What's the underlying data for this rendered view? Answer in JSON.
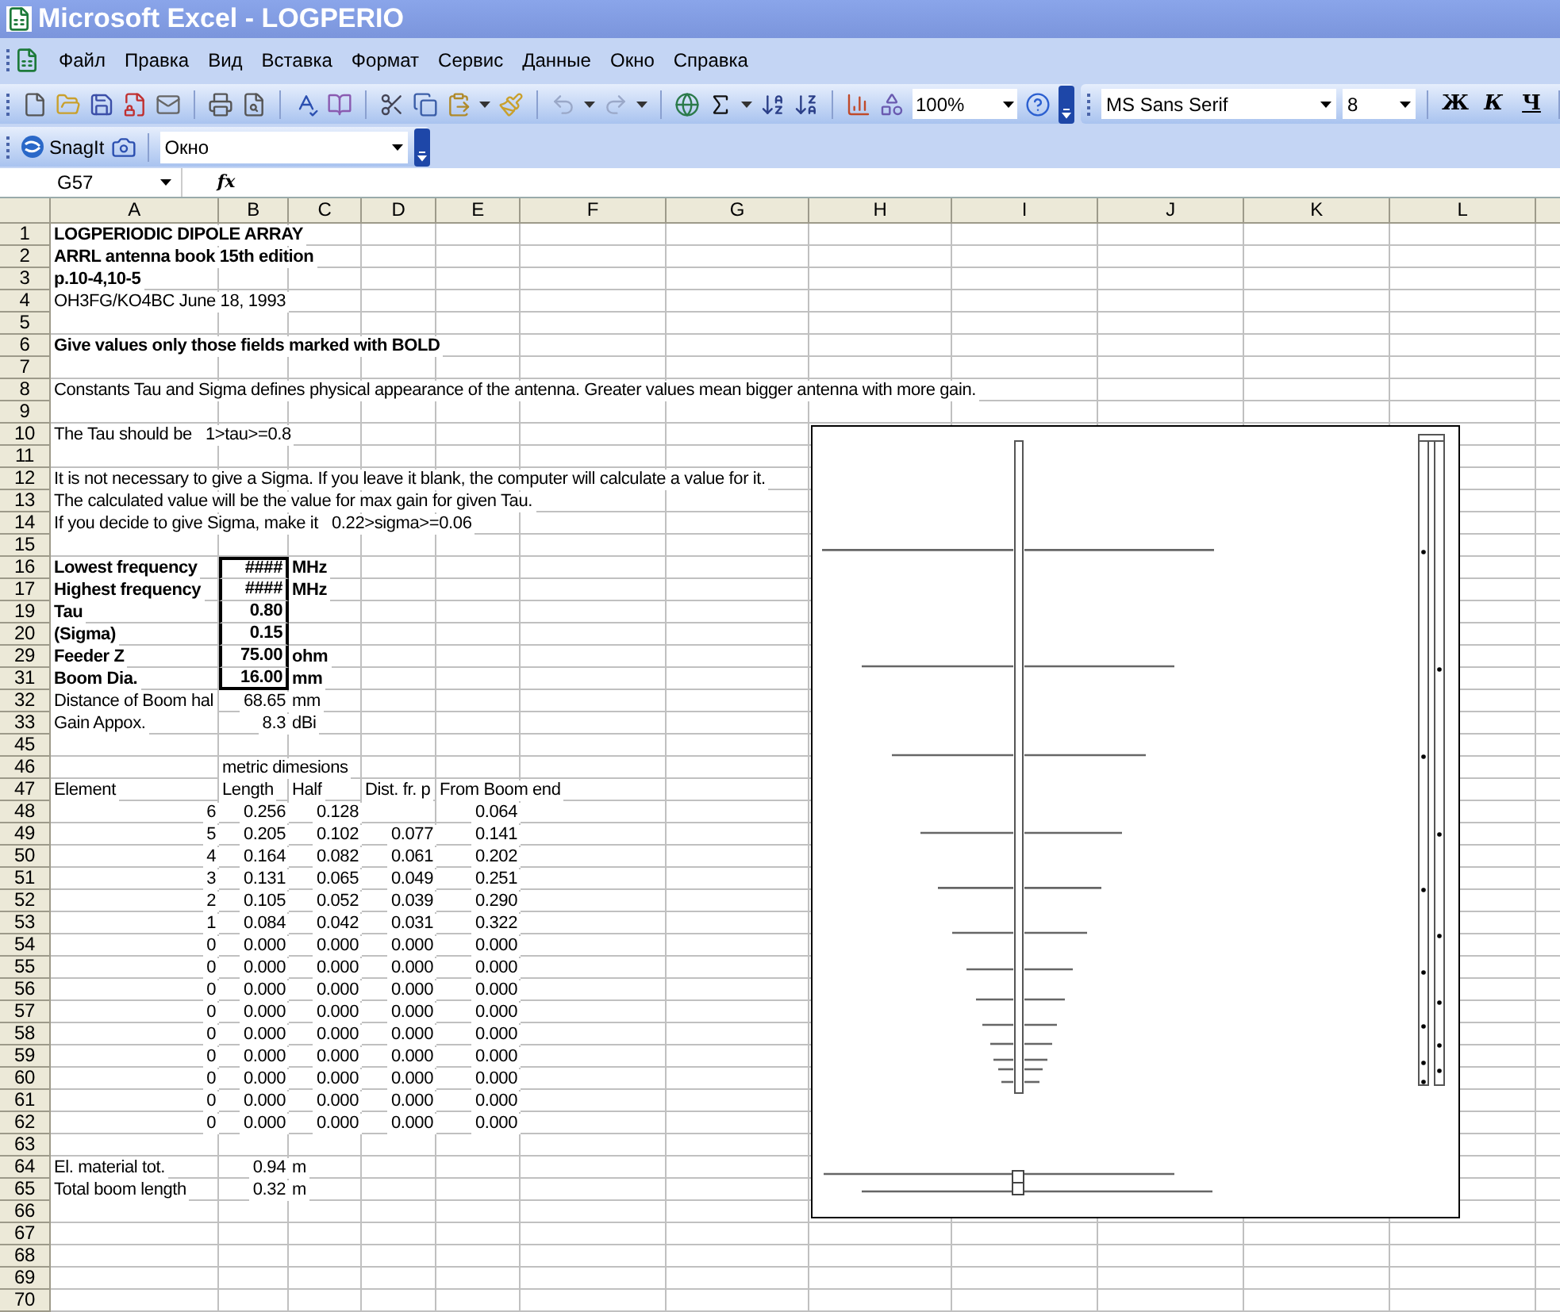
{
  "window": {
    "title": "Microsoft Excel - LOGPERIO"
  },
  "menu": [
    "Файл",
    "Правка",
    "Вид",
    "Вставка",
    "Формат",
    "Сервис",
    "Данные",
    "Окно",
    "Справка"
  ],
  "standard_toolbar": {
    "zoom": "100%"
  },
  "formatting_toolbar": {
    "font": "MS Sans Serif",
    "size": "8",
    "style_buttons": [
      "Ж",
      "К",
      "Ч"
    ]
  },
  "snagit_toolbar": {
    "label": "SnagIt",
    "dropdown": "Окно"
  },
  "formula_bar": {
    "name_box": "G57",
    "function_label": "fx"
  },
  "columns": [
    "A",
    "B",
    "C",
    "D",
    "E",
    "F",
    "G",
    "H",
    "I",
    "J",
    "K",
    "L"
  ],
  "rows": [
    {
      "header": "1",
      "cells": [
        {
          "text": "LOGPERIODIC DIPOLE ARRAY",
          "kind": "text",
          "bold": true,
          "boxed": false
        }
      ]
    },
    {
      "header": "2",
      "cells": [
        {
          "text": "ARRL antenna book 15th edition",
          "kind": "text",
          "bold": true,
          "boxed": false
        }
      ]
    },
    {
      "header": "3",
      "cells": [
        {
          "text": "p.10-4,10-5",
          "kind": "text",
          "bold": true,
          "boxed": false
        }
      ]
    },
    {
      "header": "4",
      "cells": [
        {
          "text": "OH3FG/KO4BC June 18, 1993",
          "kind": "text",
          "bold": false,
          "boxed": false
        }
      ]
    },
    {
      "header": "5",
      "cells": []
    },
    {
      "header": "6",
      "cells": [
        {
          "text": "Give values only those fields marked with BOLD",
          "kind": "text",
          "bold": true,
          "boxed": false
        }
      ]
    },
    {
      "header": "7",
      "cells": []
    },
    {
      "header": "8",
      "cells": [
        {
          "text": "Constants Tau and Sigma defines physical appearance of the antenna. Greater values mean bigger antenna with more gain.",
          "kind": "text",
          "bold": false,
          "boxed": false
        }
      ]
    },
    {
      "header": "9",
      "cells": []
    },
    {
      "header": "10",
      "cells": [
        {
          "text": "The Tau should be   1>tau>=0.8",
          "kind": "text",
          "bold": false,
          "boxed": false
        }
      ]
    },
    {
      "header": "11",
      "cells": []
    },
    {
      "header": "12",
      "cells": [
        {
          "text": "It is not necessary to give a Sigma. If you leave it blank, the computer will calculate a value for it.",
          "kind": "text",
          "bold": false,
          "boxed": false
        }
      ]
    },
    {
      "header": "13",
      "cells": [
        {
          "text": "The calculated value will be the value for max gain for given Tau.",
          "kind": "text",
          "bold": false,
          "boxed": false
        }
      ]
    },
    {
      "header": "14",
      "cells": [
        {
          "text": "If you decide to give Sigma, make it   0.22>sigma>=0.06",
          "kind": "text",
          "bold": false,
          "boxed": false
        }
      ]
    },
    {
      "header": "15",
      "cells": []
    },
    {
      "header": "16",
      "cells": [
        {
          "text": "Lowest frequency",
          "kind": "text",
          "bold": true,
          "boxed": false
        },
        {
          "text": "####",
          "kind": "number",
          "bold": true,
          "boxed": true
        },
        {
          "text": "MHz",
          "kind": "text",
          "bold": true,
          "boxed": false
        }
      ]
    },
    {
      "header": "17",
      "cells": [
        {
          "text": "Highest frequency",
          "kind": "text",
          "bold": true,
          "boxed": false
        },
        {
          "text": "####",
          "kind": "number",
          "bold": true,
          "boxed": true
        },
        {
          "text": "MHz",
          "kind": "text",
          "bold": true,
          "boxed": false
        }
      ]
    },
    {
      "header": "19",
      "cells": [
        {
          "text": "Tau",
          "kind": "text",
          "bold": true,
          "boxed": false
        },
        {
          "text": "0.80",
          "kind": "number",
          "bold": true,
          "boxed": true
        }
      ]
    },
    {
      "header": "20",
      "cells": [
        {
          "text": "(Sigma)",
          "kind": "text",
          "bold": true,
          "boxed": false
        },
        {
          "text": "0.15",
          "kind": "number",
          "bold": true,
          "boxed": true
        }
      ]
    },
    {
      "header": "29",
      "cells": [
        {
          "text": "Feeder Z",
          "kind": "text",
          "bold": true,
          "boxed": false
        },
        {
          "text": "75.00",
          "kind": "number",
          "bold": true,
          "boxed": true
        },
        {
          "text": "ohm",
          "kind": "text",
          "bold": true,
          "boxed": false
        }
      ]
    },
    {
      "header": "31",
      "cells": [
        {
          "text": "Boom Dia.",
          "kind": "text",
          "bold": true,
          "boxed": false
        },
        {
          "text": "16.00",
          "kind": "number",
          "bold": true,
          "boxed": true
        },
        {
          "text": "mm",
          "kind": "text",
          "bold": true,
          "boxed": false
        }
      ]
    },
    {
      "header": "32",
      "cells": [
        {
          "text": "Distance of Boom hal",
          "kind": "text",
          "bold": false,
          "boxed": false
        },
        {
          "text": "68.65",
          "kind": "number",
          "bold": false,
          "boxed": false
        },
        {
          "text": "mm",
          "kind": "text",
          "bold": false,
          "boxed": false
        }
      ]
    },
    {
      "header": "33",
      "cells": [
        {
          "text": "Gain Appox.",
          "kind": "text",
          "bold": false,
          "boxed": false
        },
        {
          "text": "8.3",
          "kind": "number",
          "bold": false,
          "boxed": false
        },
        {
          "text": "dBi",
          "kind": "text",
          "bold": false,
          "boxed": false
        }
      ]
    },
    {
      "header": "45",
      "cells": []
    },
    {
      "header": "46",
      "cells": [
        null,
        {
          "text": "metric dimesions",
          "kind": "text",
          "bold": false,
          "boxed": false
        }
      ]
    },
    {
      "header": "47",
      "cells": [
        {
          "text": "Element",
          "kind": "text",
          "bold": false,
          "boxed": false
        },
        {
          "text": "Length",
          "kind": "text",
          "bold": false,
          "boxed": false
        },
        {
          "text": "Half",
          "kind": "text",
          "bold": false,
          "boxed": false
        },
        {
          "text": "Dist. fr. p",
          "kind": "text",
          "bold": false,
          "boxed": false
        },
        {
          "text": "From Boom end",
          "kind": "text",
          "bold": false,
          "boxed": false
        }
      ]
    },
    {
      "header": "48",
      "cells": [
        {
          "text": "6",
          "kind": "number",
          "bold": false,
          "boxed": false
        },
        {
          "text": "0.256",
          "kind": "number",
          "bold": false,
          "boxed": false
        },
        {
          "text": "0.128",
          "kind": "number",
          "bold": false,
          "boxed": false
        },
        null,
        {
          "text": "0.064",
          "kind": "number",
          "bold": false,
          "boxed": false
        }
      ]
    },
    {
      "header": "49",
      "cells": [
        {
          "text": "5",
          "kind": "number",
          "bold": false,
          "boxed": false
        },
        {
          "text": "0.205",
          "kind": "number",
          "bold": false,
          "boxed": false
        },
        {
          "text": "0.102",
          "kind": "number",
          "bold": false,
          "boxed": false
        },
        {
          "text": "0.077",
          "kind": "number",
          "bold": false,
          "boxed": false
        },
        {
          "text": "0.141",
          "kind": "number",
          "bold": false,
          "boxed": false
        }
      ]
    },
    {
      "header": "50",
      "cells": [
        {
          "text": "4",
          "kind": "number",
          "bold": false,
          "boxed": false
        },
        {
          "text": "0.164",
          "kind": "number",
          "bold": false,
          "boxed": false
        },
        {
          "text": "0.082",
          "kind": "number",
          "bold": false,
          "boxed": false
        },
        {
          "text": "0.061",
          "kind": "number",
          "bold": false,
          "boxed": false
        },
        {
          "text": "0.202",
          "kind": "number",
          "bold": false,
          "boxed": false
        }
      ]
    },
    {
      "header": "51",
      "cells": [
        {
          "text": "3",
          "kind": "number",
          "bold": false,
          "boxed": false
        },
        {
          "text": "0.131",
          "kind": "number",
          "bold": false,
          "boxed": false
        },
        {
          "text": "0.065",
          "kind": "number",
          "bold": false,
          "boxed": false
        },
        {
          "text": "0.049",
          "kind": "number",
          "bold": false,
          "boxed": false
        },
        {
          "text": "0.251",
          "kind": "number",
          "bold": false,
          "boxed": false
        }
      ]
    },
    {
      "header": "52",
      "cells": [
        {
          "text": "2",
          "kind": "number",
          "bold": false,
          "boxed": false
        },
        {
          "text": "0.105",
          "kind": "number",
          "bold": false,
          "boxed": false
        },
        {
          "text": "0.052",
          "kind": "number",
          "bold": false,
          "boxed": false
        },
        {
          "text": "0.039",
          "kind": "number",
          "bold": false,
          "boxed": false
        },
        {
          "text": "0.290",
          "kind": "number",
          "bold": false,
          "boxed": false
        }
      ]
    },
    {
      "header": "53",
      "cells": [
        {
          "text": "1",
          "kind": "number",
          "bold": false,
          "boxed": false
        },
        {
          "text": "0.084",
          "kind": "number",
          "bold": false,
          "boxed": false
        },
        {
          "text": "0.042",
          "kind": "number",
          "bold": false,
          "boxed": false
        },
        {
          "text": "0.031",
          "kind": "number",
          "bold": false,
          "boxed": false
        },
        {
          "text": "0.322",
          "kind": "number",
          "bold": false,
          "boxed": false
        }
      ]
    },
    {
      "header": "54",
      "cells": [
        {
          "text": "0",
          "kind": "number",
          "bold": false,
          "boxed": false
        },
        {
          "text": "0.000",
          "kind": "number",
          "bold": false,
          "boxed": false
        },
        {
          "text": "0.000",
          "kind": "number",
          "bold": false,
          "boxed": false
        },
        {
          "text": "0.000",
          "kind": "number",
          "bold": false,
          "boxed": false
        },
        {
          "text": "0.000",
          "kind": "number",
          "bold": false,
          "boxed": false
        }
      ]
    },
    {
      "header": "55",
      "cells": [
        {
          "text": "0",
          "kind": "number",
          "bold": false,
          "boxed": false
        },
        {
          "text": "0.000",
          "kind": "number",
          "bold": false,
          "boxed": false
        },
        {
          "text": "0.000",
          "kind": "number",
          "bold": false,
          "boxed": false
        },
        {
          "text": "0.000",
          "kind": "number",
          "bold": false,
          "boxed": false
        },
        {
          "text": "0.000",
          "kind": "number",
          "bold": false,
          "boxed": false
        }
      ]
    },
    {
      "header": "56",
      "cells": [
        {
          "text": "0",
          "kind": "number",
          "bold": false,
          "boxed": false
        },
        {
          "text": "0.000",
          "kind": "number",
          "bold": false,
          "boxed": false
        },
        {
          "text": "0.000",
          "kind": "number",
          "bold": false,
          "boxed": false
        },
        {
          "text": "0.000",
          "kind": "number",
          "bold": false,
          "boxed": false
        },
        {
          "text": "0.000",
          "kind": "number",
          "bold": false,
          "boxed": false
        }
      ]
    },
    {
      "header": "57",
      "cells": [
        {
          "text": "0",
          "kind": "number",
          "bold": false,
          "boxed": false
        },
        {
          "text": "0.000",
          "kind": "number",
          "bold": false,
          "boxed": false
        },
        {
          "text": "0.000",
          "kind": "number",
          "bold": false,
          "boxed": false
        },
        {
          "text": "0.000",
          "kind": "number",
          "bold": false,
          "boxed": false
        },
        {
          "text": "0.000",
          "kind": "number",
          "bold": false,
          "boxed": false
        }
      ]
    },
    {
      "header": "58",
      "cells": [
        {
          "text": "0",
          "kind": "number",
          "bold": false,
          "boxed": false
        },
        {
          "text": "0.000",
          "kind": "number",
          "bold": false,
          "boxed": false
        },
        {
          "text": "0.000",
          "kind": "number",
          "bold": false,
          "boxed": false
        },
        {
          "text": "0.000",
          "kind": "number",
          "bold": false,
          "boxed": false
        },
        {
          "text": "0.000",
          "kind": "number",
          "bold": false,
          "boxed": false
        }
      ]
    },
    {
      "header": "59",
      "cells": [
        {
          "text": "0",
          "kind": "number",
          "bold": false,
          "boxed": false
        },
        {
          "text": "0.000",
          "kind": "number",
          "bold": false,
          "boxed": false
        },
        {
          "text": "0.000",
          "kind": "number",
          "bold": false,
          "boxed": false
        },
        {
          "text": "0.000",
          "kind": "number",
          "bold": false,
          "boxed": false
        },
        {
          "text": "0.000",
          "kind": "number",
          "bold": false,
          "boxed": false
        }
      ]
    },
    {
      "header": "60",
      "cells": [
        {
          "text": "0",
          "kind": "number",
          "bold": false,
          "boxed": false
        },
        {
          "text": "0.000",
          "kind": "number",
          "bold": false,
          "boxed": false
        },
        {
          "text": "0.000",
          "kind": "number",
          "bold": false,
          "boxed": false
        },
        {
          "text": "0.000",
          "kind": "number",
          "bold": false,
          "boxed": false
        },
        {
          "text": "0.000",
          "kind": "number",
          "bold": false,
          "boxed": false
        }
      ]
    },
    {
      "header": "61",
      "cells": [
        {
          "text": "0",
          "kind": "number",
          "bold": false,
          "boxed": false
        },
        {
          "text": "0.000",
          "kind": "number",
          "bold": false,
          "boxed": false
        },
        {
          "text": "0.000",
          "kind": "number",
          "bold": false,
          "boxed": false
        },
        {
          "text": "0.000",
          "kind": "number",
          "bold": false,
          "boxed": false
        },
        {
          "text": "0.000",
          "kind": "number",
          "bold": false,
          "boxed": false
        }
      ]
    },
    {
      "header": "62",
      "cells": [
        {
          "text": "0",
          "kind": "number",
          "bold": false,
          "boxed": false
        },
        {
          "text": "0.000",
          "kind": "number",
          "bold": false,
          "boxed": false
        },
        {
          "text": "0.000",
          "kind": "number",
          "bold": false,
          "boxed": false
        },
        {
          "text": "0.000",
          "kind": "number",
          "bold": false,
          "boxed": false
        },
        {
          "text": "0.000",
          "kind": "number",
          "bold": false,
          "boxed": false
        }
      ]
    },
    {
      "header": "63",
      "cells": []
    },
    {
      "header": "64",
      "cells": [
        {
          "text": "El. material tot.",
          "kind": "text",
          "bold": false,
          "boxed": false
        },
        {
          "text": "0.94",
          "kind": "number",
          "bold": false,
          "boxed": false
        },
        {
          "text": "m",
          "kind": "text",
          "bold": false,
          "boxed": false
        }
      ]
    },
    {
      "header": "65",
      "cells": [
        {
          "text": "Total boom length",
          "kind": "text",
          "bold": false,
          "boxed": false
        },
        {
          "text": "0.32",
          "kind": "number",
          "bold": false,
          "boxed": false
        },
        {
          "text": "m",
          "kind": "text",
          "bold": false,
          "boxed": false
        }
      ]
    },
    {
      "header": "66",
      "cells": []
    },
    {
      "header": "67",
      "cells": []
    },
    {
      "header": "68",
      "cells": []
    },
    {
      "header": "69",
      "cells": []
    },
    {
      "header": "70",
      "cells": []
    }
  ]
}
